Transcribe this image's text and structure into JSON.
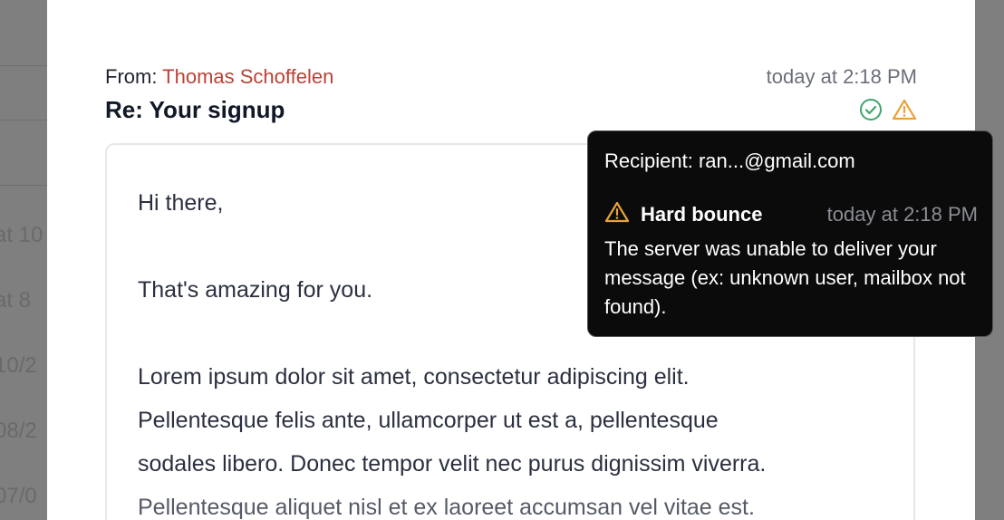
{
  "background_list": {
    "dates": [
      "at 10",
      "at 8",
      "10/2",
      "08/2",
      "07/0"
    ]
  },
  "email": {
    "from_label": "From:",
    "from_name": "Thomas Schoffelen",
    "time": "today at 2:18 PM",
    "subject": "Re: Your signup",
    "status_icons": [
      "check-circle-icon",
      "warning-icon"
    ],
    "body": {
      "greeting": "Hi there,",
      "line1": "That's amazing for you.",
      "para": [
        "Lorem ipsum dolor sit amet, consectetur adipiscing elit.",
        "Pellentesque felis ante, ullamcorper ut est a, pellentesque",
        "sodales libero. Donec tempor velit nec purus dignissim viverra.",
        "Pellentesque aliquet nisl et ex laoreet accumsan vel vitae est."
      ]
    }
  },
  "tooltip": {
    "recipient": "Recipient: ran...@gmail.com",
    "event_title": "Hard bounce",
    "event_time": "today at 2:18 PM",
    "description": "The server was unable to deliver your message (ex: unknown user, mailbox not found)."
  },
  "colors": {
    "sender": "#b84336",
    "success": "#3fa56b",
    "warning": "#e8a23a",
    "tooltip_bg": "#0b0b0b"
  }
}
